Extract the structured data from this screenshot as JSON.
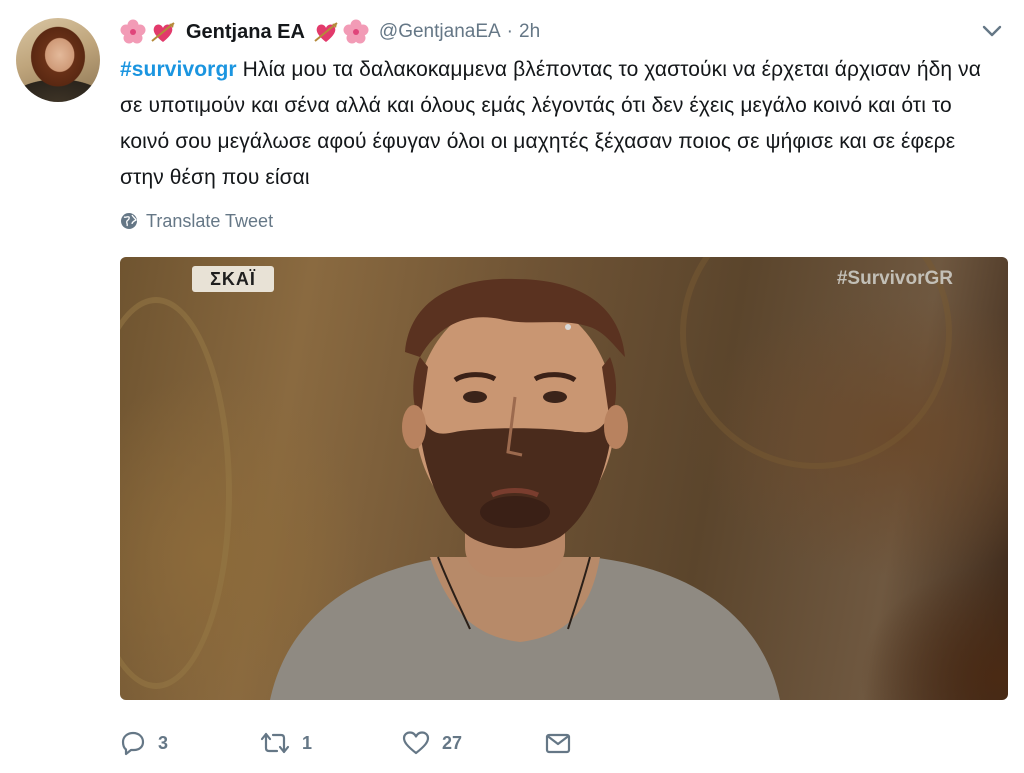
{
  "tweet": {
    "display_name": "Gentjana EA",
    "handle": "@GentjanaEA",
    "separator": "·",
    "time": "2h",
    "hashtag": "#survivorgr",
    "body": " Ηλία μου τα δαλακοκαμμενα βλέποντας το χαστούκι να έρχεται άρχισαν ήδη να σε υποτιμούν και σένα αλλά και όλους εμάς λέγοντάς ότι δεν έχεις μεγάλο κοινό και ότι το κοινό σου μεγάλωσε αφού έφυγαν όλοι οι μαχητές ξέχασαν ποιος σε ψήφισε και σε έφερε στην θέση που είσαι",
    "translate_label": "Translate Tweet",
    "media": {
      "channel_logo": "ΣΚΑΪ",
      "watermark": "#SurvivorGR"
    },
    "actions": {
      "reply_count": "3",
      "retweet_count": "1",
      "like_count": "27"
    }
  },
  "colors": {
    "hashtag": "#1b95e0",
    "muted": "#657786",
    "text": "#14171a"
  },
  "icons": {
    "emojis": [
      "hibiscus-icon",
      "heart-arrow-icon",
      "heart-arrow-icon",
      "hibiscus-icon"
    ],
    "menu": "chevron-down-icon",
    "translate": "globe-icon",
    "reply": "reply-icon",
    "retweet": "retweet-icon",
    "like": "heart-icon",
    "dm": "envelope-icon"
  }
}
